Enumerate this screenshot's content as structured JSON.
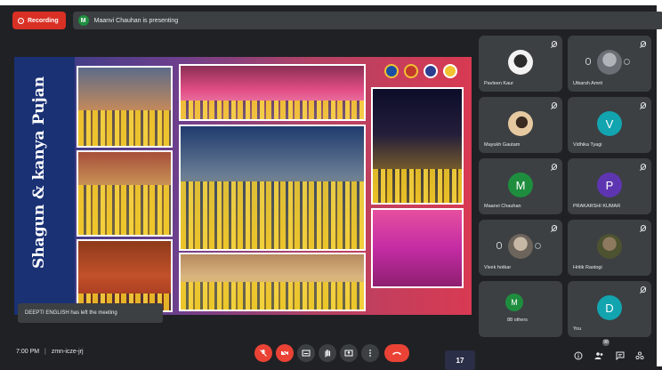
{
  "header": {
    "recording_label": "Recording",
    "presenter_initial": "M",
    "presenting_text": "Maanvi Chauhan is presenting"
  },
  "slide": {
    "title": "Shagun & kanya Pujan",
    "page_number": "17"
  },
  "toast": {
    "text": "DEEPTI ENGLISH has left the meeting"
  },
  "participants": [
    {
      "name": "Pavleen Kaur",
      "avatar_type": "photo",
      "color": "#d9d9d9"
    },
    {
      "name": "Utkarsh Amrit",
      "avatar_type": "photo",
      "color": "#8c8f94"
    },
    {
      "name": "Mayukh Gautam",
      "avatar_type": "photo",
      "color": "#c9a983"
    },
    {
      "name": "Vidhika Tyagi",
      "avatar_type": "letter",
      "initial": "V",
      "color": "#12a4af"
    },
    {
      "name": "Maanvi Chauhan",
      "avatar_type": "letter",
      "initial": "M",
      "color": "#1e8e3e"
    },
    {
      "name": "PRAKARSHI KUMAR",
      "avatar_type": "letter",
      "initial": "P",
      "color": "#5e35b1"
    },
    {
      "name": "Vivek hotkar",
      "avatar_type": "photo",
      "color": "#8a7f74"
    },
    {
      "name": "Hritik Rastogi",
      "avatar_type": "photo",
      "color": "#6b6e4a"
    },
    {
      "name": "88 others",
      "avatar_type": "letter",
      "initial": "M",
      "color": "#1e8e3e"
    },
    {
      "name": "You",
      "avatar_type": "letter",
      "initial": "D",
      "color": "#12a4af"
    }
  ],
  "bottom": {
    "time": "7:00 PM",
    "separator": "|",
    "meeting_code": "zmn-icze-jrj",
    "people_count": "98"
  },
  "colors": {
    "recording_red": "#d93025",
    "end_call_red": "#ea4335",
    "control_gray": "#3c4043"
  }
}
